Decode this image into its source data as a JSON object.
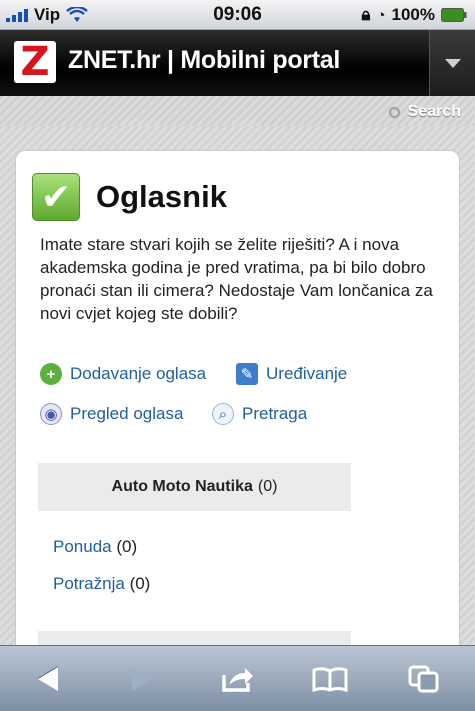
{
  "status_bar": {
    "carrier": "Vip",
    "time": "09:06",
    "battery": "100%"
  },
  "header": {
    "logo_letter": "Z",
    "title": "ZNET.hr | Mobilni portal"
  },
  "search": {
    "label": "Search"
  },
  "section": {
    "title": "Oglasnik",
    "description": "Imate stare stvari kojih se želite riješiti? A i nova akademska godina je pred vratima, pa bi bilo dobro pronaći stan ili cimera? Nedostaje Vam lončanica za novi cvjet kojeg ste dobili?",
    "actions": [
      {
        "label": "Dodavanje oglasa",
        "icon": "add-icon"
      },
      {
        "label": "Uređivanje",
        "icon": "edit-icon"
      },
      {
        "label": "Pregled oglasa",
        "icon": "eye-icon"
      },
      {
        "label": "Pretraga",
        "icon": "search-icon"
      }
    ]
  },
  "category": {
    "name": "Auto Moto Nautika",
    "count": "(0)",
    "items": [
      {
        "label": "Ponuda",
        "count": "(0)"
      },
      {
        "label": "Potražnja",
        "count": "(0)"
      }
    ]
  },
  "toolbar": {
    "icons": [
      "back-icon",
      "forward-icon",
      "share-icon",
      "bookmarks-icon",
      "tabs-icon"
    ]
  }
}
